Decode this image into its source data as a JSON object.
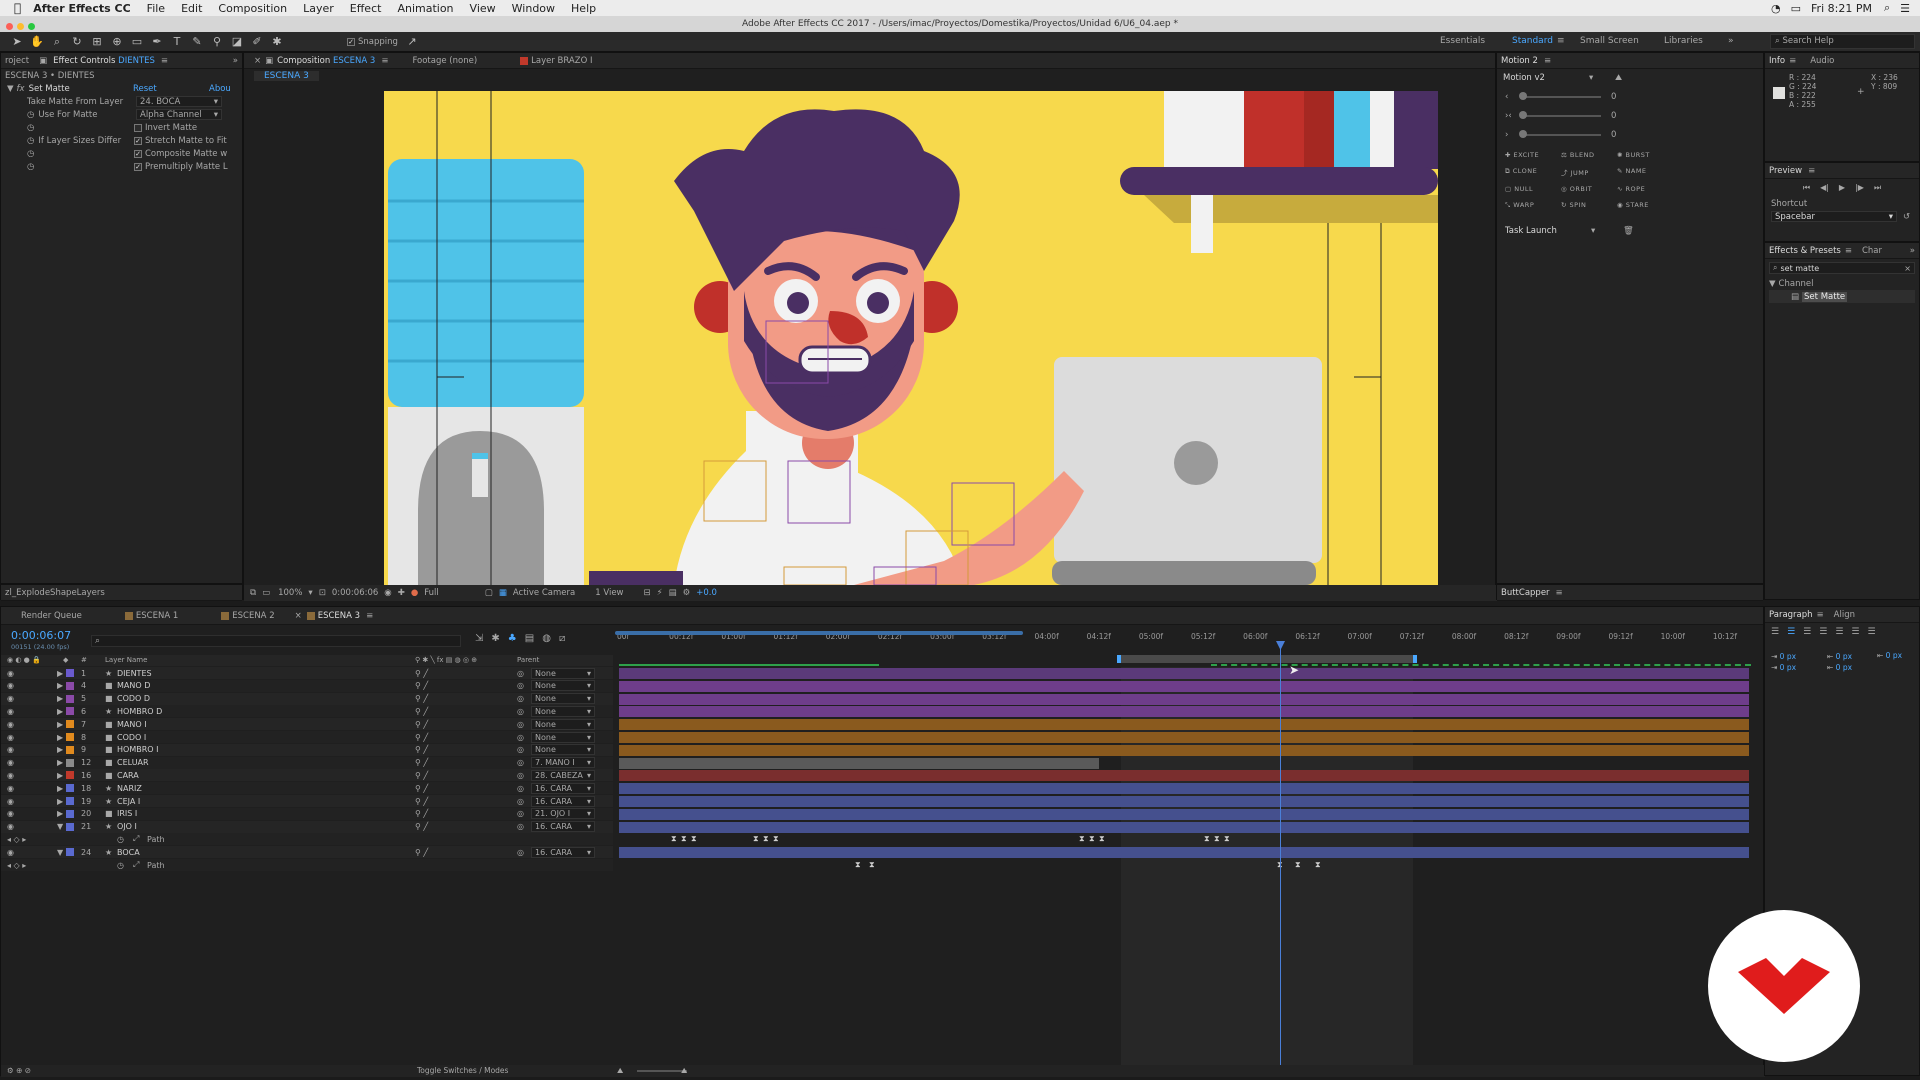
{
  "menubar": {
    "items": [
      "After Effects CC",
      "File",
      "Edit",
      "Composition",
      "Layer",
      "Effect",
      "Animation",
      "View",
      "Window",
      "Help"
    ],
    "clock": "Fri 8:21 PM"
  },
  "window_title": "Adobe After Effects CC 2017 - /Users/imac/Proyectos/Domestika/Proyectos/Unidad 6/U6_04.aep *",
  "toolbar": {
    "snapping_label": "Snapping"
  },
  "workspaces": [
    "Essentials",
    "Standard",
    "Small Screen",
    "Libraries"
  ],
  "search_help": "Search Help",
  "effect_controls": {
    "tab_project": "roject",
    "tab_label": "Effect Controls",
    "tab_layer": "DIENTES",
    "breadcrumb": "ESCENA 3 • DIENTES",
    "effect_name": "Set Matte",
    "reset": "Reset",
    "about": "Abou",
    "take_matte_label": "Take Matte From Layer",
    "take_matte_value": "24. BOCA",
    "use_for_matte_label": "Use For Matte",
    "use_for_matte_value": "Alpha Channel",
    "invert_matte": "Invert Matte",
    "if_sizes_label": "If Layer Sizes Differ",
    "stretch": "Stretch Matte to Fit",
    "composite": "Composite Matte w",
    "premultiply": "Premultiply Matte L"
  },
  "viewer": {
    "tab_composition": "Composition",
    "tab_comp_name": "ESCENA 3",
    "tab_footage": "Footage (none)",
    "tab_layer": "Layer BRAZO I",
    "sub_tab": "ESCENA 3",
    "zoom": "100%",
    "timecode": "0:00:06:06",
    "resolution": "Full",
    "camera": "Active Camera",
    "views": "1 View",
    "exposure": "+0.0"
  },
  "scripts_panel": {
    "title": "zl_ExplodeShapeLayers"
  },
  "motion": {
    "tab": "Motion 2",
    "version": "Motion v2",
    "slider_values": [
      "0",
      "0",
      "0"
    ],
    "buttons": [
      "EXCITE",
      "BLEND",
      "BURST",
      "CLONE",
      "JUMP",
      "NAME",
      "NULL",
      "ORBIT",
      "ROPE",
      "WARP",
      "SPIN",
      "STARE"
    ],
    "task": "Task Launch"
  },
  "buttcapper": {
    "title": "ButtCapper"
  },
  "info": {
    "tab_info": "Info",
    "tab_audio": "Audio",
    "r": "R : 224",
    "g": "G : 224",
    "b": "B : 222",
    "a": "A : 255",
    "x": "X : 236",
    "y": "Y : 809",
    "swatch_color": "#e0e0de"
  },
  "preview": {
    "title": "Preview",
    "shortcut_label": "Shortcut",
    "shortcut_value": "Spacebar"
  },
  "effects_presets": {
    "tab": "Effects & Presets",
    "tab_char": "Char",
    "search": "set matte",
    "category": "Channel",
    "item": "Set Matte"
  },
  "paragraph": {
    "tab": "Paragraph",
    "tab_align": "Align",
    "values": [
      "0 px",
      "0 px",
      "0 px",
      "0 px",
      "0 px"
    ]
  },
  "timeline": {
    "tabs": [
      "Render Queue",
      "ESCENA 1",
      "ESCENA 2",
      "ESCENA 3"
    ],
    "timecode": "0:00:06:07",
    "frame_info": "00151 (24.00 fps)",
    "col_layer_name": "Layer Name",
    "col_parent": "Parent",
    "ruler": [
      "00f",
      "00:12f",
      "01:00f",
      "01:12f",
      "02:00f",
      "02:12f",
      "03:00f",
      "03:12f",
      "04:00f",
      "04:12f",
      "05:00f",
      "05:12f",
      "06:00f",
      "06:12f",
      "07:00f",
      "07:12f",
      "08:00f",
      "08:12f",
      "09:00f",
      "09:12f",
      "10:00f",
      "10:12f"
    ],
    "layers": [
      {
        "num": "1",
        "name": "DIENTES",
        "label": "#6a5acd",
        "parent": "None",
        "bar": "#5b3a7a",
        "star": true
      },
      {
        "num": "4",
        "name": "MANO D",
        "label": "#8b4aa8",
        "parent": "None",
        "bar": "#6e3d8a",
        "star": false
      },
      {
        "num": "5",
        "name": "CODO D",
        "label": "#8b4aa8",
        "parent": "None",
        "bar": "#6e3d8a",
        "star": false
      },
      {
        "num": "6",
        "name": "HOMBRO D",
        "label": "#8b4aa8",
        "parent": "None",
        "bar": "#6e3d8a",
        "star": true
      },
      {
        "num": "7",
        "name": "MANO I",
        "label": "#e08a1e",
        "parent": "None",
        "bar": "#8a5a1e",
        "star": false
      },
      {
        "num": "8",
        "name": "CODO I",
        "label": "#e08a1e",
        "parent": "None",
        "bar": "#8a5a1e",
        "star": false
      },
      {
        "num": "9",
        "name": "HOMBRO I",
        "label": "#e08a1e",
        "parent": "None",
        "bar": "#8a5a1e",
        "star": false
      },
      {
        "num": "12",
        "name": "CELUAR",
        "label": "#8a8a8a",
        "parent": "7. MANO I",
        "bar": "#5a5a5a",
        "star": false
      },
      {
        "num": "16",
        "name": "CARA",
        "label": "#c0392b",
        "parent": "28. CABEZA",
        "bar": "#7a2e2e",
        "star": false
      },
      {
        "num": "18",
        "name": "NARIZ",
        "label": "#5a6ad0",
        "parent": "16. CARA",
        "bar": "#45508e",
        "star": true
      },
      {
        "num": "19",
        "name": "CEJA I",
        "label": "#5a6ad0",
        "parent": "16. CARA",
        "bar": "#45508e",
        "star": true
      },
      {
        "num": "20",
        "name": "IRIS I",
        "label": "#5a6ad0",
        "parent": "21. OJO I",
        "bar": "#45508e",
        "star": false
      },
      {
        "num": "21",
        "name": "OJO I",
        "label": "#5a6ad0",
        "parent": "16. CARA",
        "bar": "#45508e",
        "star": true
      },
      {
        "num": "",
        "name": "Path",
        "label": "",
        "parent": "",
        "bar": "",
        "star": false
      },
      {
        "num": "24",
        "name": "BOCA",
        "label": "#5a6ad0",
        "parent": "16. CARA",
        "bar": "#45508e",
        "star": true
      },
      {
        "num": "",
        "name": "Path",
        "label": "",
        "parent": "",
        "bar": "",
        "star": false
      }
    ],
    "toggle_label": "Toggle Switches / Modes"
  }
}
